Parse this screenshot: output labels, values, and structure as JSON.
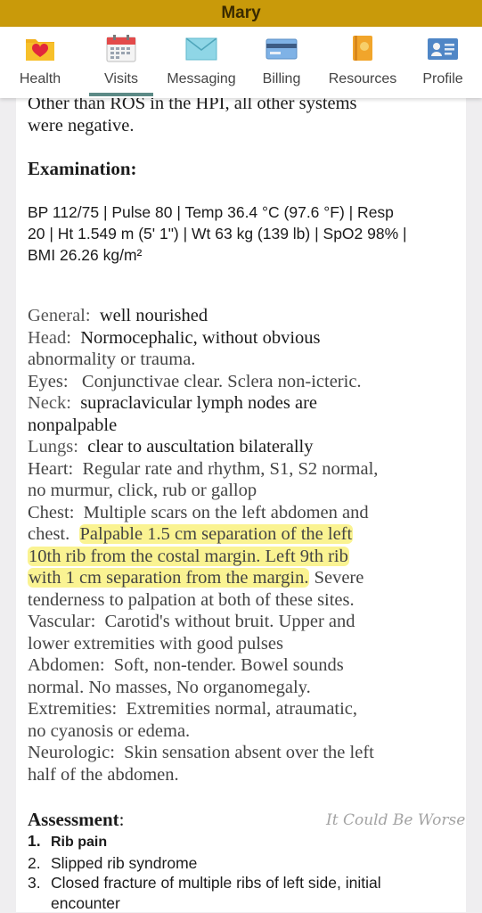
{
  "app": {
    "title": "Mary"
  },
  "nav": {
    "tabs": [
      {
        "label": "Health",
        "icon": "heart-folder-icon"
      },
      {
        "label": "Visits",
        "icon": "calendar-icon",
        "active": true
      },
      {
        "label": "Messaging",
        "icon": "envelope-icon"
      },
      {
        "label": "Billing",
        "icon": "credit-card-icon"
      },
      {
        "label": "Resources",
        "icon": "book-icon"
      },
      {
        "label": "Profile",
        "icon": "id-card-icon"
      }
    ]
  },
  "note": {
    "ros_tail_1": "Other than ROS in the HPI, all other systems",
    "ros_tail_2": "were negative.",
    "exam_heading": "Examination:",
    "vitals": [
      "BP 112/75 | Pulse 80 | Temp 36.4 °C (97.6 °F) | Resp",
      "20 | Ht 1.549 m (5' 1\") | Wt 63 kg (139 lb) | SpO2 98% |",
      "BMI 26.26 kg/m²"
    ],
    "exam": {
      "general_label": "General:",
      "general": "well nourished",
      "head_label": "Head:",
      "head_1": "Normocephalic, without obvious",
      "head_2": "abnormality or trauma.",
      "eyes_label": "Eyes:",
      "eyes": "Conjunctivae clear. Sclera non-icteric.",
      "neck_label": "Neck:",
      "neck_1": "supraclavicular lymph nodes are",
      "neck_2": "nonpalpable",
      "lungs_label": "Lungs:",
      "lungs": "clear to auscultation  bilaterally",
      "heart_label": "Heart:",
      "heart_1": "Regular rate and rhythm, S1, S2 normal,",
      "heart_2": "no murmur, click, rub or gallop",
      "chest_label": "Chest:",
      "chest_1": "Multiple scars on the left abdomen and",
      "chest_2a": "chest.",
      "chest_2b": "Palpable 1.5 cm separation of the left",
      "chest_3": "10th rib from the costal margin.  Left 9th rib",
      "chest_4a": "with 1 cm separation from the margin.",
      "chest_4b": "Severe",
      "chest_5": "tenderness to palpation at both of these sites.",
      "vascular_label": "Vascular:",
      "vascular_1": "Carotid's without bruit. Upper and",
      "vascular_2": "lower extremities with good pulses",
      "abdomen_label": "Abdomen:",
      "abdomen_1": "Soft, non-tender. Bowel sounds",
      "abdomen_2": "normal. No masses,  No organomegaly.",
      "extremities_label": "Extremities:",
      "extremities_1": "Extremities normal, atraumatic,",
      "extremities_2": "no cyanosis or edema.",
      "neurologic_label": "Neurologic:",
      "neurologic_1": "Skin sensation absent over the left",
      "neurologic_2": "half of the abdomen."
    },
    "assessment_heading": "Assessment",
    "assessment_colon": ":",
    "assessment": [
      {
        "num": "1.",
        "text": "Rib pain"
      },
      {
        "num": "2.",
        "text": "Slipped rib syndrome"
      },
      {
        "num": "3.",
        "text": "Closed fracture of multiple ribs of left side, initial"
      },
      {
        "num": "",
        "text": "encounter"
      }
    ]
  },
  "watermark": "It Could Be Worse",
  "colors": {
    "topbar": "#c99a0a",
    "highlight": "#faf28c",
    "tab_underline": "#5c8a86"
  }
}
